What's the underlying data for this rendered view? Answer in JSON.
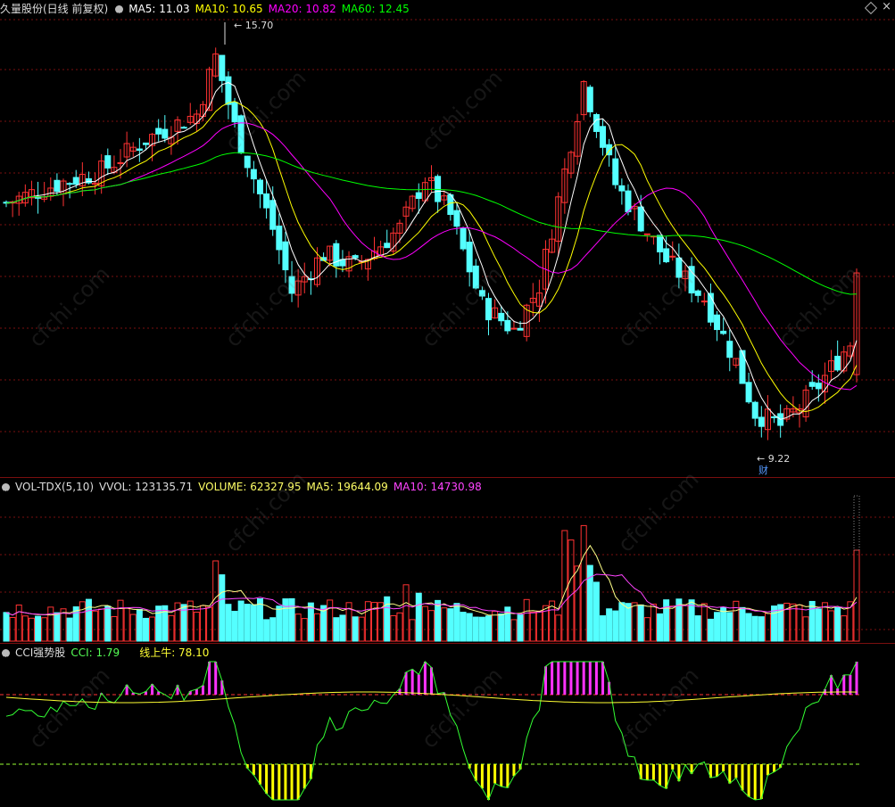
{
  "main": {
    "title": "久量股份(日线 前复权)",
    "ma5_label": "MA5: 11.03",
    "ma10_label": "MA10: 10.65",
    "ma20_label": "MA20: 10.82",
    "ma60_label": "MA60: 12.45",
    "high_label": "15.70",
    "low_label": "9.22",
    "event_label": "财",
    "colors": {
      "up": "#ff3232",
      "down": "#54ffff",
      "ma5": "#ffffff",
      "ma10": "#ffff00",
      "ma20": "#ff00ff",
      "ma60": "#00ff00",
      "grid": "#7a0f0f"
    }
  },
  "volume": {
    "title": "VOL-TDX(5,10)",
    "vol_label": "VVOL: 123135.71",
    "volume_label": "VOLUME: 62327.95",
    "ma5_label": "MA5: 19644.09",
    "ma10_label": "MA10: 14730.98"
  },
  "cci": {
    "title": "CCI强势股",
    "cci_label": "CCI: 1.79",
    "line_label": "线上牛: 78.10"
  },
  "icons": {
    "settings": "circle-chevron-icon",
    "restore": "diamond-icon",
    "close": "close-icon"
  },
  "watermark": "cfchi.com",
  "chart_data": [
    {
      "type": "candlestick",
      "title": "久量股份(日线 前复权)",
      "series": [
        {
          "name": "MA5",
          "last": 11.03
        },
        {
          "name": "MA10",
          "last": 10.65
        },
        {
          "name": "MA20",
          "last": 10.82
        },
        {
          "name": "MA60",
          "last": 12.45
        }
      ],
      "annotations": [
        {
          "label": "15.70",
          "kind": "high"
        },
        {
          "label": "9.22",
          "kind": "low"
        },
        {
          "label": "财",
          "kind": "event"
        }
      ]
    },
    {
      "type": "bar",
      "title": "VOL-TDX(5,10)",
      "series": [
        {
          "name": "VOLUME",
          "last": 62327.95
        },
        {
          "name": "MA5",
          "last": 19644.09
        },
        {
          "name": "MA10",
          "last": 14730.98
        }
      ]
    },
    {
      "type": "line",
      "title": "CCI强势股",
      "series": [
        {
          "name": "CCI",
          "last": 1.79
        },
        {
          "name": "线上牛",
          "last": 78.1
        }
      ]
    }
  ]
}
